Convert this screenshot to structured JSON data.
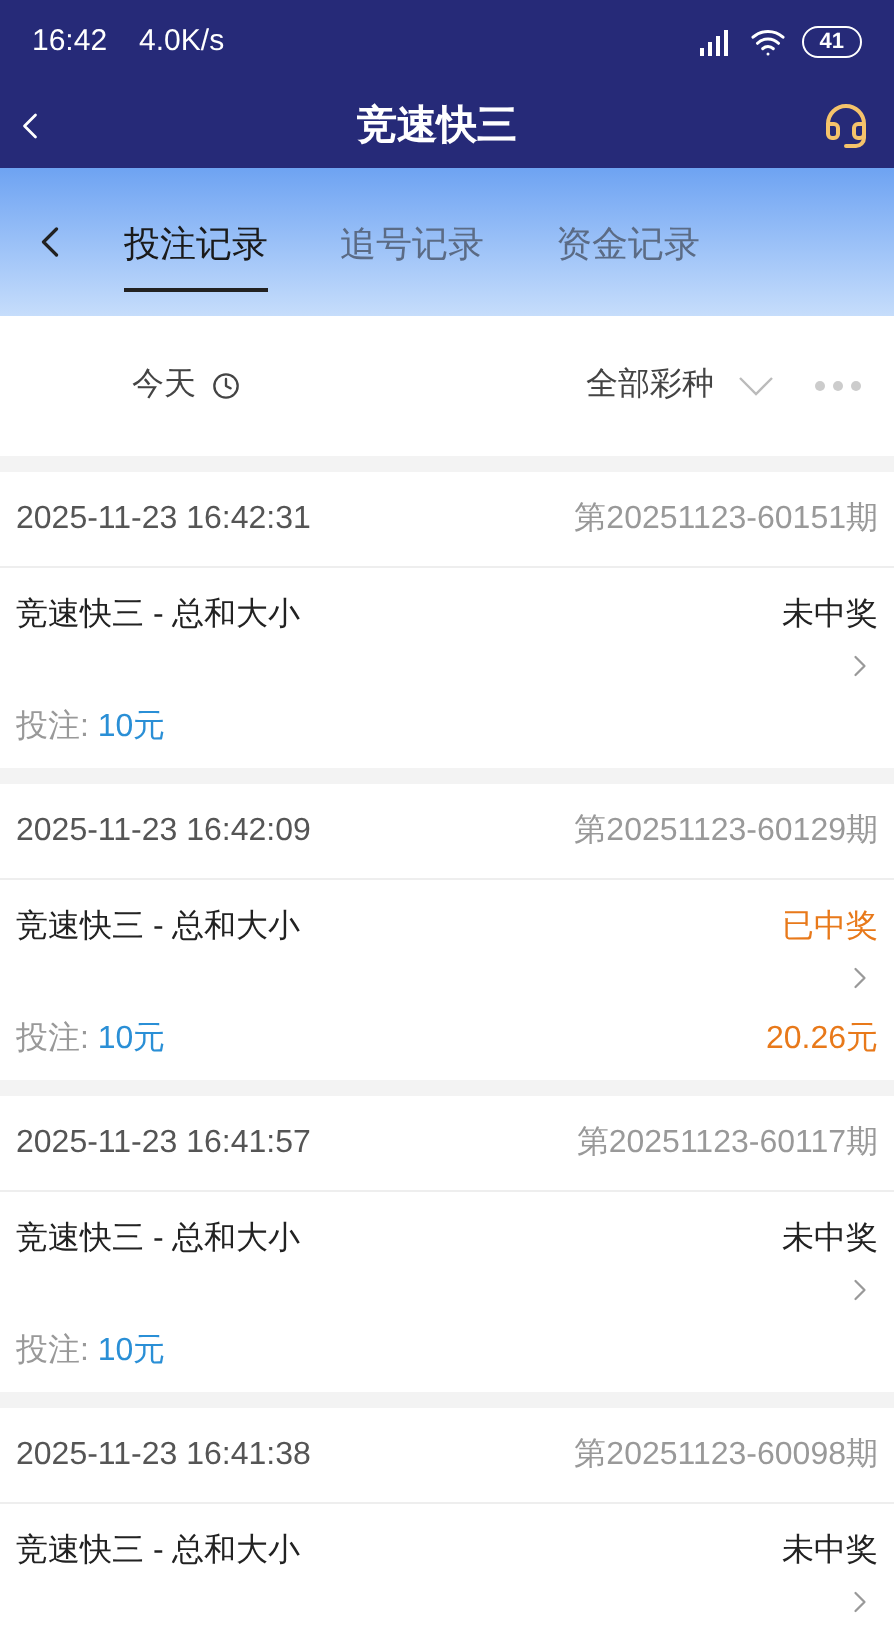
{
  "status_bar": {
    "time": "16:42",
    "speed": "4.0K/s",
    "battery": "41"
  },
  "header": {
    "title": "竞速快三"
  },
  "tabs": [
    {
      "label": "投注记录",
      "selected": true
    },
    {
      "label": "追号记录",
      "selected": false
    },
    {
      "label": "资金记录",
      "selected": false
    }
  ],
  "filters": {
    "date": "今天",
    "lottery": "全部彩种"
  },
  "records": [
    {
      "time": "2025-11-23 16:42:31",
      "issue": "第20251123-60151期",
      "game": "竞速快三 - 总和大小",
      "status": "未中奖",
      "won": false,
      "bet_label": "投注:",
      "bet": "10元"
    },
    {
      "time": "2025-11-23 16:42:09",
      "issue": "第20251123-60129期",
      "game": "竞速快三 - 总和大小",
      "status": "已中奖",
      "won": true,
      "bet_label": "投注:",
      "bet": "10元",
      "prize": "20.26元"
    },
    {
      "time": "2025-11-23 16:41:57",
      "issue": "第20251123-60117期",
      "game": "竞速快三 - 总和大小",
      "status": "未中奖",
      "won": false,
      "bet_label": "投注:",
      "bet": "10元"
    },
    {
      "time": "2025-11-23 16:41:38",
      "issue": "第20251123-60098期",
      "game": "竞速快三 - 总和大小",
      "status": "未中奖",
      "won": false
    }
  ]
}
